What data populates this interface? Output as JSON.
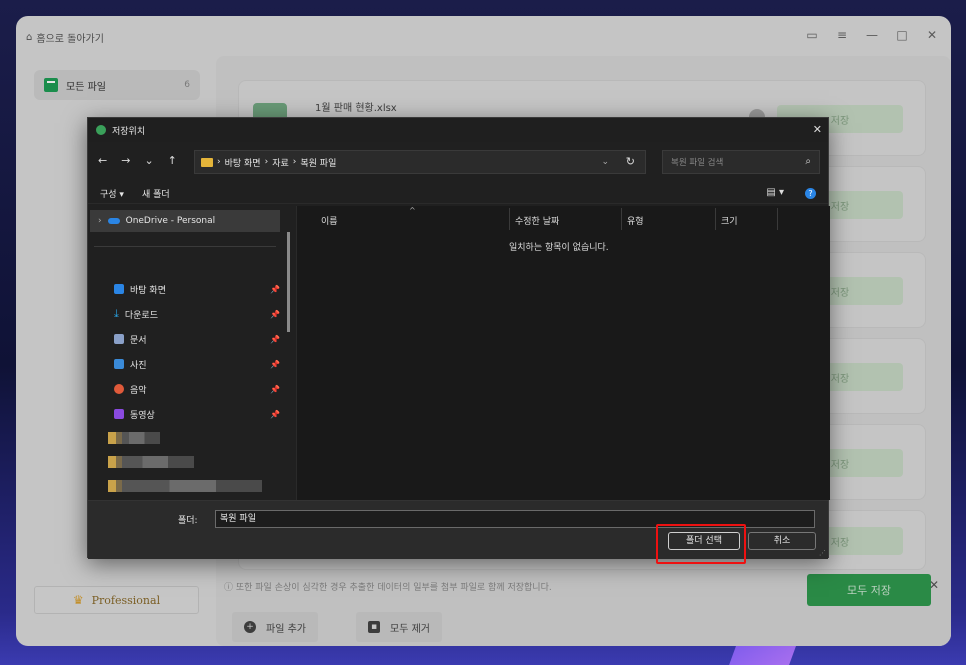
{
  "app": {
    "home_label": "홈으로 돌아가기",
    "sidebar": {
      "all_files_label": "모든 파일",
      "all_files_count": "6",
      "pro_label": "Professional"
    },
    "cards": [
      {
        "name": "1월 판매 현황.xlsx",
        "save_label": "저장"
      },
      {
        "name": "",
        "save_label": "저장"
      },
      {
        "name": "",
        "save_label": "저장"
      },
      {
        "name": "",
        "save_label": "저장"
      },
      {
        "name": "",
        "save_label": "저장"
      },
      {
        "name": "",
        "save_label": "저장"
      }
    ],
    "warning": "ⓘ 또한 파일 손상이 심각한 경우 추출한 데이터의 일부를 첨부 파일로 함께 저장합니다.",
    "add_file_label": "파일 추가",
    "remove_all_label": "모두 제거",
    "save_all_label": "모두 저장"
  },
  "dialog": {
    "title": "저장위치",
    "path": [
      "바탕 화면",
      "자료",
      "복원 파일"
    ],
    "search_placeholder": "복원 파일 검색",
    "organize_label": "구성 ▾",
    "new_folder_label": "새 폴더",
    "onedrive_label": "OneDrive - Personal",
    "quick_access": [
      {
        "label": "바탕 화면",
        "icon": "desktop-icon",
        "color": "#2a85e5"
      },
      {
        "label": "다운로드",
        "icon": "download-icon",
        "color": "#2aa5e5"
      },
      {
        "label": "문서",
        "icon": "document-icon",
        "color": "#8aa0c8"
      },
      {
        "label": "사진",
        "icon": "pictures-icon",
        "color": "#3a8ad8"
      },
      {
        "label": "음악",
        "icon": "music-icon",
        "color": "#e05a3a"
      },
      {
        "label": "동영상",
        "icon": "video-icon",
        "color": "#8a4ae0"
      }
    ],
    "columns": {
      "name": "이름",
      "modified": "수정한 날짜",
      "type": "유형",
      "size": "크기"
    },
    "empty_message": "일치하는 항목이 없습니다.",
    "folder_label": "폴더:",
    "folder_value": "복원 파일",
    "select_folder_label": "폴더 선택",
    "cancel_label": "취소"
  }
}
